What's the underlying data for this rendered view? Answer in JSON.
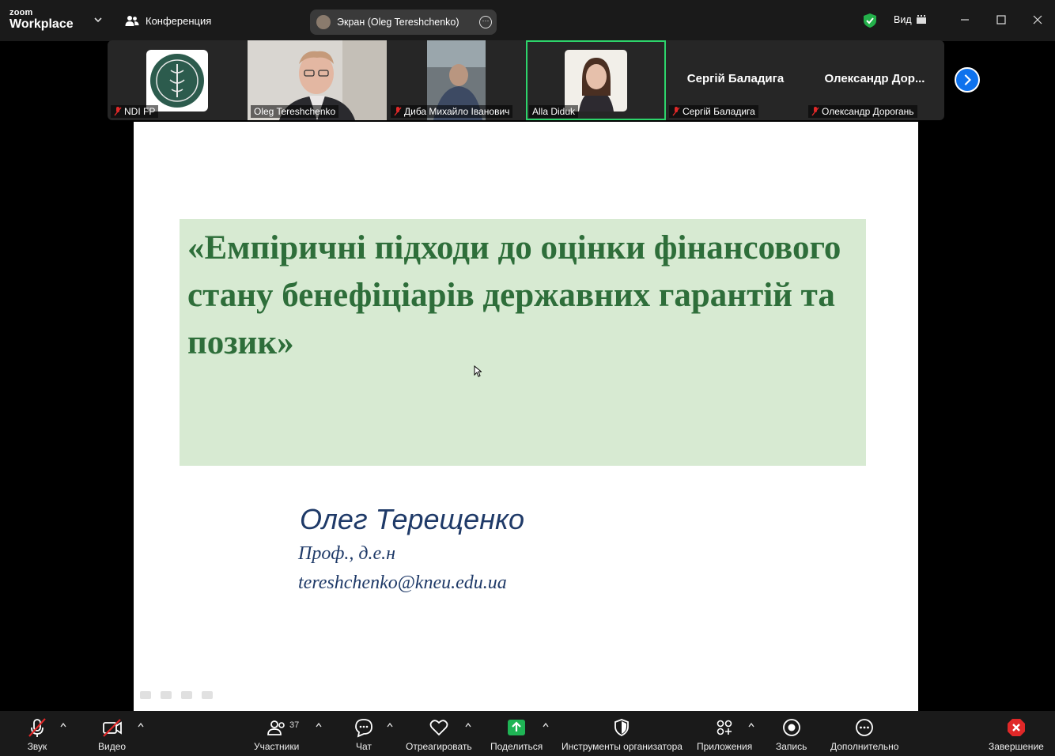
{
  "app": {
    "brand_small": "zoom",
    "brand_big": "Workplace"
  },
  "titlebar": {
    "meeting_label": "Конференция",
    "screen_share_label": "Экран (Oleg Tereshchenko)",
    "view_label": "Вид"
  },
  "participants": [
    {
      "name": "NDI FP",
      "muted": true
    },
    {
      "name": "Oleg Tereshchenko",
      "muted": false
    },
    {
      "name": "Диба Михайло Іванович",
      "muted": true
    },
    {
      "name": "Alla Diduk",
      "muted": false,
      "active": true
    },
    {
      "name": "Сергій Баладига",
      "display": "Сергій Баладига",
      "muted": true
    },
    {
      "name": "Олександр Дорогань",
      "display": "Олександр  Дор...",
      "muted": true
    }
  ],
  "slide": {
    "title": "«Емпіричні підходи до оцінки фінансового стану бенефіціарів державних гарантій та позик»",
    "author": "Олег Терещенко",
    "degree": "Проф., д.е.н",
    "email": "tereshchenko@kneu.edu.ua"
  },
  "toolbar": {
    "audio": "Звук",
    "video": "Видео",
    "participants": "Участники",
    "participants_count": "37",
    "chat": "Чат",
    "react": "Отреагировать",
    "share": "Поделиться",
    "host_tools": "Инструменты организатора",
    "apps": "Приложения",
    "record": "Запись",
    "more": "Дополнительно",
    "end": "Завершение"
  },
  "colors": {
    "active_border": "#2dd46b",
    "share_green": "#1fb455",
    "end_red": "#e02828",
    "slide_title": "#2e6e3a",
    "slide_author": "#1f3a68",
    "slide_box": "#d7ead2"
  }
}
